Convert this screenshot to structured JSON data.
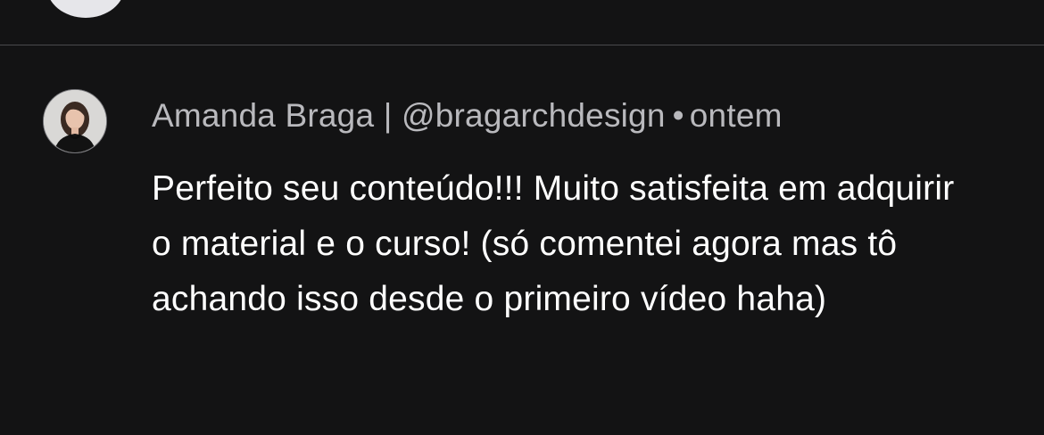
{
  "previous_item": {
    "avatar_icon": "avatar-icon"
  },
  "comment": {
    "author": "Amanda Braga | @bragarchdesign",
    "separator": "•",
    "timestamp": "ontem",
    "text": "Perfeito seu conteúdo!!! Muito satisfeita em adquirir o material e o curso! (só comentei agora mas tô achando isso desde o primeiro vídeo haha)",
    "avatar_icon": "avatar-icon"
  },
  "colors": {
    "background": "#131314",
    "divider": "#4a4a4d",
    "meta_text": "#b9b9bd",
    "body_text": "#ffffff"
  }
}
